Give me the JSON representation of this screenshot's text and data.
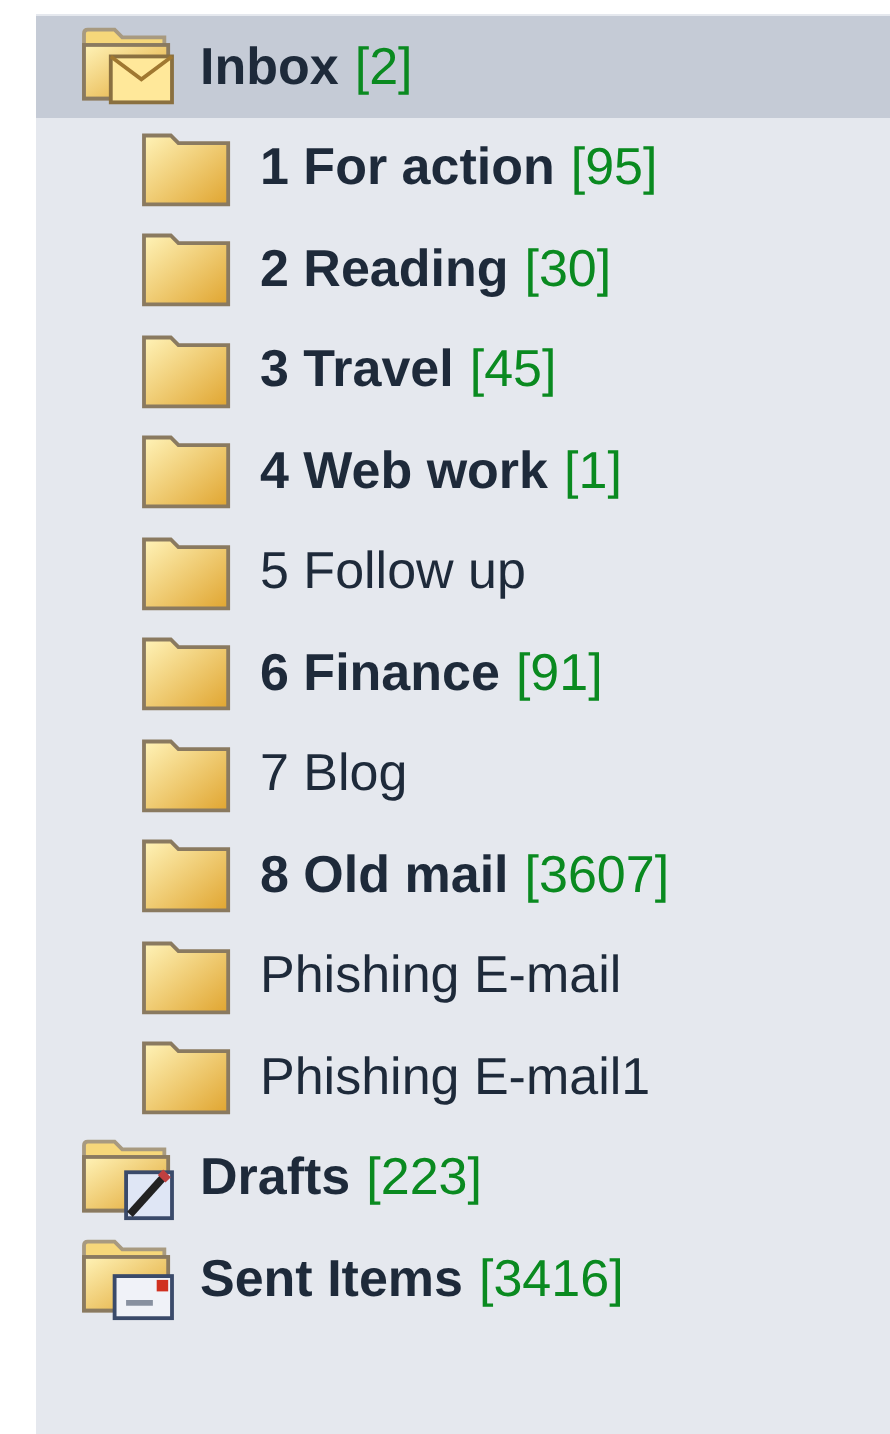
{
  "folders": [
    {
      "kind": "inbox",
      "name": "Inbox",
      "count": "[2]",
      "selected": true,
      "children": [
        {
          "kind": "folder",
          "name": "1 For action",
          "count": "[95]",
          "selected": false
        },
        {
          "kind": "folder",
          "name": "2 Reading",
          "count": "[30]",
          "selected": false
        },
        {
          "kind": "folder",
          "name": "3 Travel",
          "count": "[45]",
          "selected": false
        },
        {
          "kind": "folder",
          "name": "4 Web work",
          "count": "[1]",
          "selected": false
        },
        {
          "kind": "folder",
          "name": "5 Follow up",
          "selected": false
        },
        {
          "kind": "folder",
          "name": "6 Finance",
          "count": "[91]",
          "selected": false
        },
        {
          "kind": "folder",
          "name": "7 Blog",
          "selected": false
        },
        {
          "kind": "folder",
          "name": "8 Old mail",
          "count": "[3607]",
          "selected": false
        },
        {
          "kind": "folder",
          "name": "Phishing E-mail",
          "selected": false
        },
        {
          "kind": "folder",
          "name": "Phishing E-mail1",
          "selected": false
        }
      ]
    },
    {
      "kind": "drafts",
      "name": "Drafts",
      "count": "[223]",
      "selected": false
    },
    {
      "kind": "sent",
      "name": "Sent Items",
      "count": "[3416]",
      "selected": false
    }
  ]
}
